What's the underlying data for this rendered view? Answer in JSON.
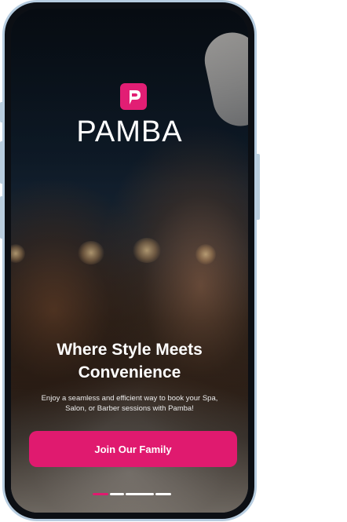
{
  "brand": {
    "name": "PAMBA",
    "accent": "#e01a6f"
  },
  "onboarding": {
    "headline": "Where Style Meets Convenience",
    "description": "Enjoy a seamless and efficient way to book your Spa, Salon, or Barber sessions with Pamba!",
    "cta_label": "Join Our Family",
    "pager": {
      "total": 4,
      "active_index": 0
    }
  },
  "icons": {
    "logo": "pamba-logo-icon"
  }
}
